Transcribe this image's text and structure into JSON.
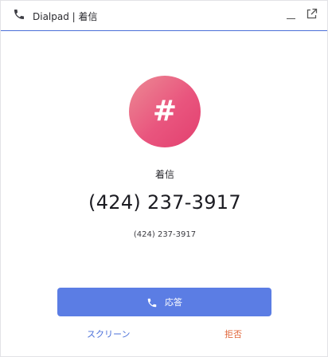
{
  "titlebar": {
    "title": "Dialpad | 着信",
    "phone_icon": "phone-icon",
    "minimize_icon": "minimize-icon",
    "popout_icon": "popout-icon"
  },
  "call": {
    "avatar_glyph": "#",
    "status": "着信",
    "number": "(424) 237-3917",
    "number_secondary": "(424) 237-3917"
  },
  "actions": {
    "answer_label": "応答",
    "answer_icon": "phone-icon",
    "screen_label": "スクリーン",
    "decline_label": "拒否"
  },
  "colors": {
    "accent": "#5b7de4",
    "decline": "#e0663a",
    "avatar_start": "#ec8a94",
    "avatar_end": "#e2406f"
  }
}
